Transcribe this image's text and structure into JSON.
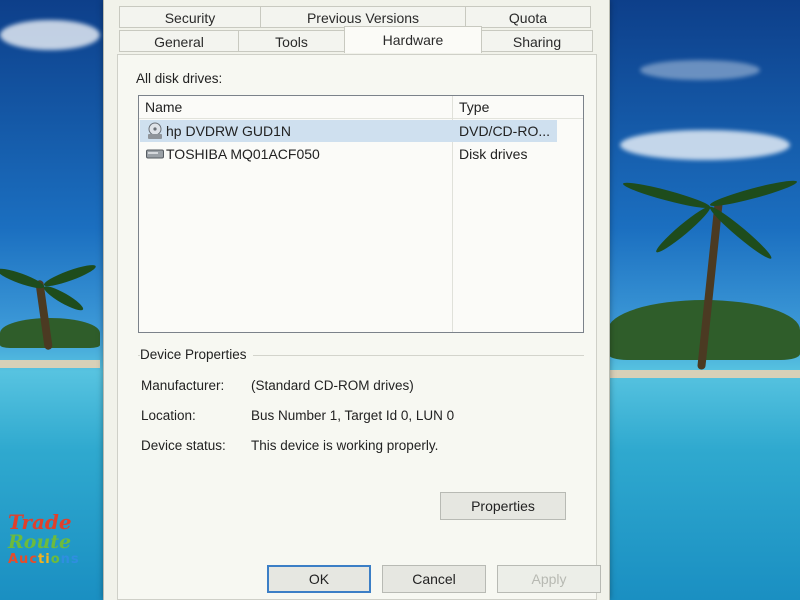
{
  "tabs": {
    "row1": [
      "Security",
      "Previous Versions",
      "Quota"
    ],
    "row2": [
      "General",
      "Tools",
      "Hardware",
      "Sharing"
    ],
    "active": "Hardware"
  },
  "hardware": {
    "list_label": "All disk drives:",
    "columns": {
      "name": "Name",
      "type": "Type"
    },
    "rows": [
      {
        "name": "hp DVDRW GUD1N",
        "type": "DVD/CD-RO...",
        "icon": "dvd-drive-icon",
        "selected": true
      },
      {
        "name": "TOSHIBA MQ01ACF050",
        "type": "Disk drives",
        "icon": "hard-disk-icon",
        "selected": false
      }
    ],
    "group_title": "Device Properties",
    "properties": {
      "manufacturer_label": "Manufacturer:",
      "manufacturer_value": "(Standard CD-ROM drives)",
      "location_label": "Location:",
      "location_value": "Bus Number 1, Target Id 0, LUN 0",
      "status_label": "Device status:",
      "status_value": "This device is working properly."
    },
    "properties_button": "Properties"
  },
  "footer": {
    "ok": "OK",
    "cancel": "Cancel",
    "apply": "Apply"
  },
  "watermark": {
    "line1": "Trade",
    "line2": "Route",
    "line3": [
      "Auc",
      "ti",
      "o",
      "ns"
    ]
  },
  "colors": {
    "selection": "#cfe0ef",
    "default_button_border": "#3c7fc6"
  }
}
